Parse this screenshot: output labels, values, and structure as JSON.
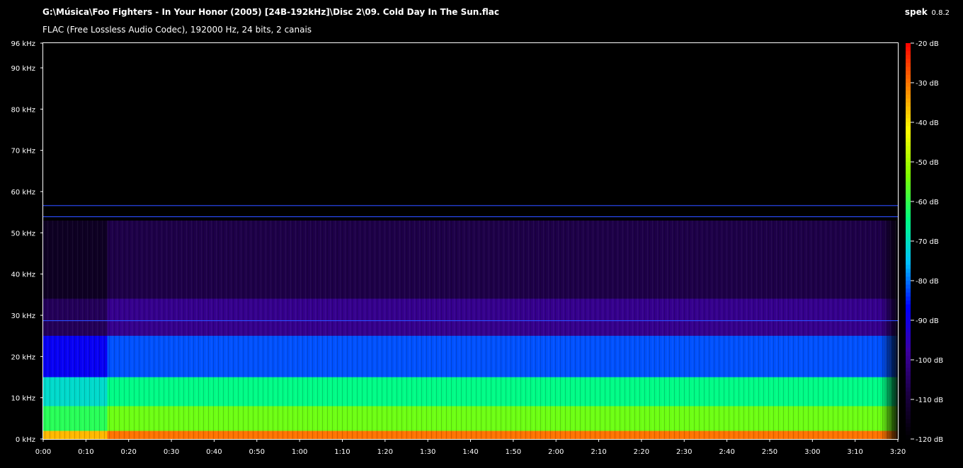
{
  "header": {
    "file_path": "G:\\Música\\Foo Fighters - In Your Honor (2005) [24B-192kHz]\\Disc 2\\09. Cold Day In The Sun.flac",
    "stream_info": "FLAC (Free Lossless Audio Codec), 192000 Hz, 24 bits, 2 canais",
    "app_name": "spek",
    "app_version": "0.8.2"
  },
  "chart_data": {
    "type": "heatmap",
    "y_tick_labels": [
      "0 kHz",
      "10 kHz",
      "20 kHz",
      "30 kHz",
      "40 kHz",
      "50 kHz",
      "60 kHz",
      "70 kHz",
      "80 kHz",
      "90 kHz",
      "96 kHz"
    ],
    "y_ticks": [
      0,
      10,
      20,
      30,
      40,
      50,
      60,
      70,
      80,
      90,
      96
    ],
    "ylim": [
      0,
      96
    ],
    "x_tick_labels": [
      "0:00",
      "0:10",
      "0:20",
      "0:30",
      "0:40",
      "0:50",
      "1:00",
      "1:10",
      "1:20",
      "1:30",
      "1:40",
      "1:50",
      "2:00",
      "2:10",
      "2:20",
      "2:30",
      "2:40",
      "2:50",
      "3:00",
      "3:10",
      "3:20"
    ],
    "x_ticks": [
      0,
      10,
      20,
      30,
      40,
      50,
      60,
      70,
      80,
      90,
      100,
      110,
      120,
      130,
      140,
      150,
      160,
      170,
      180,
      190,
      200
    ],
    "xlim": [
      0,
      200
    ],
    "colorbar": {
      "tick_labels": [
        "-20 dB",
        "-30 dB",
        "-40 dB",
        "-50 dB",
        "-60 dB",
        "-70 dB",
        "-80 dB",
        "-90 dB",
        "-100 dB",
        "-110 dB",
        "-120 dB"
      ],
      "ticks": [
        -20,
        -30,
        -40,
        -50,
        -60,
        -70,
        -80,
        -90,
        -100,
        -110,
        -120
      ],
      "range": [
        -120,
        -20
      ],
      "colors_low_to_high": [
        "#000000",
        "#1a0040",
        "#3c00a0",
        "#0000ff",
        "#00c0ff",
        "#00ff80",
        "#80ff00",
        "#ffff00",
        "#ff8000",
        "#ff0000"
      ]
    },
    "spectrum_bands": [
      {
        "from_khz": 0,
        "to_khz": 2,
        "db": -30
      },
      {
        "from_khz": 2,
        "to_khz": 8,
        "db": -55
      },
      {
        "from_khz": 8,
        "to_khz": 15,
        "db": -65
      },
      {
        "from_khz": 15,
        "to_khz": 25,
        "db": -82
      },
      {
        "from_khz": 25,
        "to_khz": 34,
        "db": -100
      },
      {
        "from_khz": 34,
        "to_khz": 53,
        "db": -108
      },
      {
        "from_khz": 53,
        "to_khz": 96,
        "db": -120
      }
    ],
    "intro_end_s": 15,
    "fade_start_s": 196,
    "horizontal_lines_khz": [
      28.7,
      53.9,
      56.6
    ]
  }
}
